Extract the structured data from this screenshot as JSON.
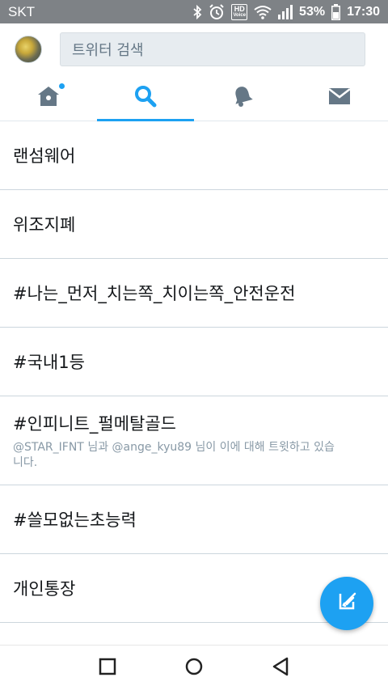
{
  "status_bar": {
    "carrier": "SKT",
    "hd_label_top": "HD",
    "hd_label_bottom": "Voice",
    "battery_percent": "53%",
    "time": "17:30"
  },
  "header": {
    "search_placeholder": "트위터 검색"
  },
  "tabs": [
    {
      "name": "home",
      "icon": "home-icon",
      "has_notification": true
    },
    {
      "name": "search",
      "icon": "search-icon",
      "active": true
    },
    {
      "name": "notifications",
      "icon": "bell-icon"
    },
    {
      "name": "messages",
      "icon": "mail-icon"
    }
  ],
  "trends": [
    {
      "term": "랜섬웨어"
    },
    {
      "term": "위조지폐"
    },
    {
      "term": "#나는_먼저_치는쪽_치이는쪽_안전운전"
    },
    {
      "term": "#국내1등"
    },
    {
      "term": "#인피니트_펄메탈골드",
      "meta": "@STAR_IFNT 님과 @ange_kyu89 님이 이에 대해 트윗하고 있습니다."
    },
    {
      "term": "#쓸모없는초능력"
    },
    {
      "term": "개인통장"
    }
  ],
  "colors": {
    "accent": "#1da1f2",
    "status_bar": "#7e8286",
    "icon_gray": "#657786"
  }
}
